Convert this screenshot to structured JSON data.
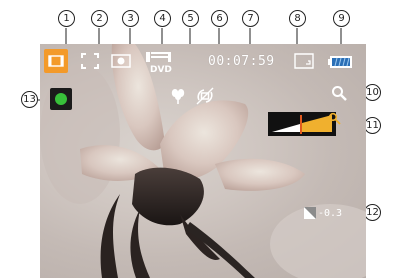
{
  "status": {
    "rec_time": "00:07:59",
    "resolution_text": "DVD"
  },
  "exposure": {
    "value": "-0.3"
  },
  "zoom": {
    "level": 0.45
  },
  "callouts": [
    "1",
    "2",
    "3",
    "4",
    "5",
    "6",
    "7",
    "8",
    "9",
    "10",
    "11",
    "12",
    "13"
  ],
  "colors": {
    "accent_orange": "#f39a2a",
    "record_green": "#38c03a",
    "battery_blue": "#2b6fb6"
  },
  "icons": {
    "video_mode": "video-mode-icon",
    "af_area": "af-area-icon",
    "metering": "metering-icon",
    "resolution": "resolution-dvd-icon",
    "macro": "macro-icon",
    "stabilizer": "stabilizer-icon",
    "memory": "memory-card-icon",
    "battery": "battery-icon",
    "zoom": "zoom-icon",
    "record": "record-button-icon",
    "exposure": "exposure-compensation-icon"
  }
}
